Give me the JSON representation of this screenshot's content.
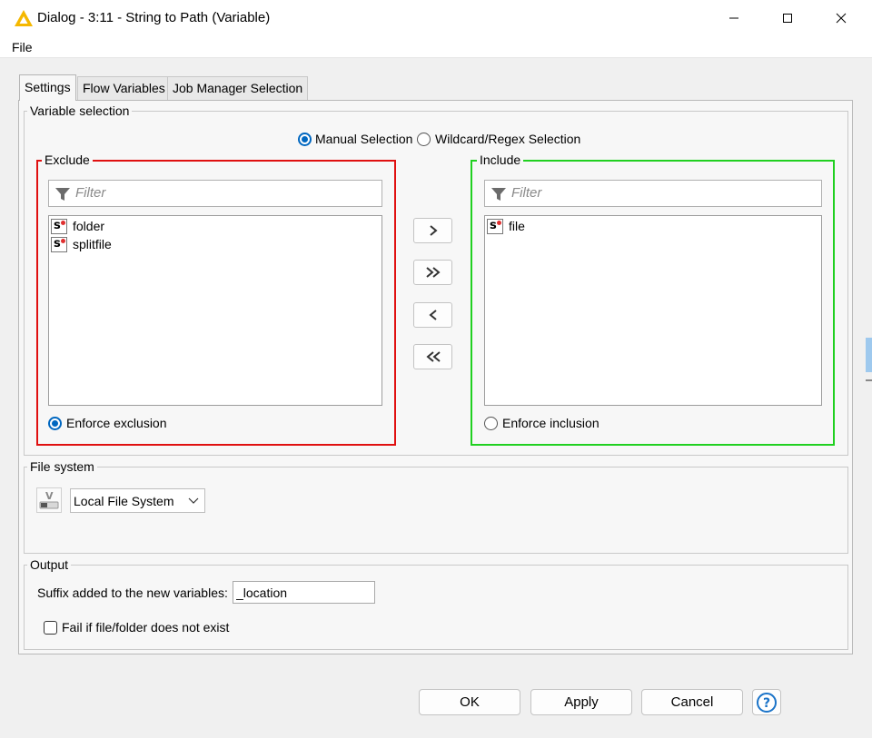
{
  "window": {
    "title": "Dialog - 3:11 - String to Path (Variable)",
    "icon": "knime-warning-triangle-icon",
    "controls": [
      "minimize-icon",
      "maximize-icon",
      "close-icon"
    ]
  },
  "menu": {
    "file": "File"
  },
  "tabs": [
    {
      "label": "Settings",
      "active": true
    },
    {
      "label": "Flow Variables",
      "active": false
    },
    {
      "label": "Job Manager Selection",
      "active": false
    }
  ],
  "variable_selection": {
    "title": "Variable selection",
    "mode_options": [
      {
        "label": "Manual Selection",
        "selected": true
      },
      {
        "label": "Wildcard/Regex Selection",
        "selected": false
      }
    ],
    "exclude": {
      "title": "Exclude",
      "filter_placeholder": "Filter",
      "items": [
        "folder",
        "splitfile"
      ],
      "enforce_label": "Enforce exclusion",
      "enforce_selected": true,
      "border_color": "#e01010"
    },
    "include": {
      "title": "Include",
      "filter_placeholder": "Filter",
      "items": [
        "file"
      ],
      "enforce_label": "Enforce inclusion",
      "enforce_selected": false,
      "border_color": "#20d020"
    },
    "move_buttons": {
      "add": ">",
      "add_all": "»",
      "remove": "<",
      "remove_all": "«"
    },
    "item_icon": "string-variable-icon"
  },
  "file_system": {
    "title": "File system",
    "selected": "Local File System"
  },
  "output": {
    "title": "Output",
    "suffix_label": "Suffix added to the new variables:",
    "suffix_value": "_location",
    "fail_label": "Fail if file/folder does not exist",
    "fail_checked": false
  },
  "buttons": {
    "ok": "OK",
    "apply": "Apply",
    "cancel": "Cancel",
    "help": "?"
  },
  "colors": {
    "accent": "#0067c0",
    "title_icon": "#f5b800"
  }
}
